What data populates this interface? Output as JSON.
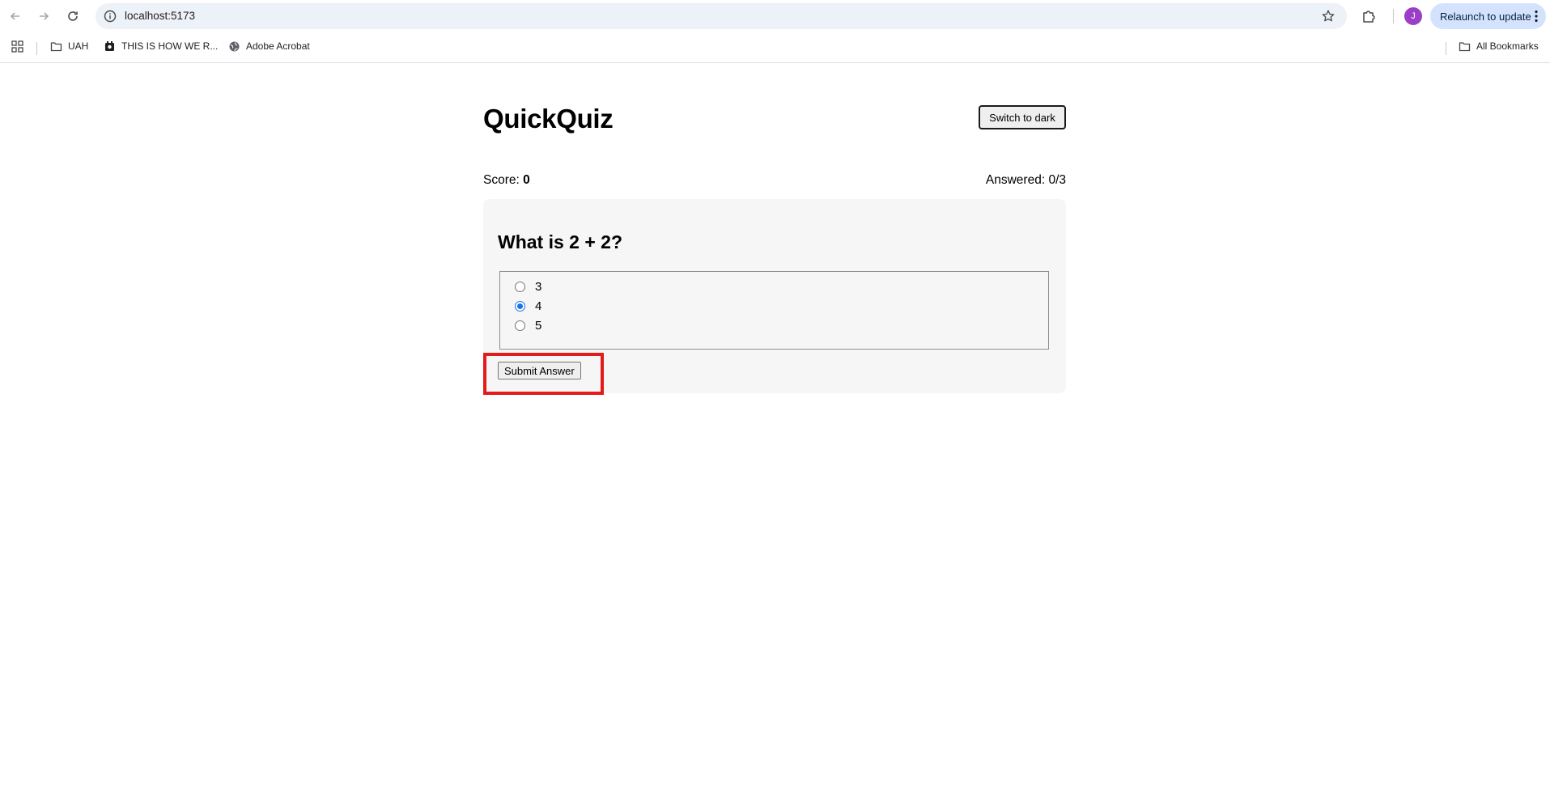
{
  "browser": {
    "url": "localhost:5173",
    "avatar_letter": "J",
    "relaunch_label": "Relaunch to update",
    "bookmarks": [
      {
        "label": "UAH",
        "icon": "folder-icon"
      },
      {
        "label": "THIS IS HOW WE R...",
        "icon": "site-icon"
      },
      {
        "label": "Adobe Acrobat",
        "icon": "globe-icon"
      }
    ],
    "all_bookmarks_label": "All Bookmarks"
  },
  "app": {
    "title": "QuickQuiz",
    "theme_button_label": "Switch to dark",
    "score_label": "Score:",
    "score_value": "0",
    "answered_text": "Answered: 0/3",
    "question": "What is 2 + 2?",
    "options": [
      {
        "label": "3",
        "selected": false
      },
      {
        "label": "4",
        "selected": true
      },
      {
        "label": "5",
        "selected": false
      }
    ],
    "submit_label": "Submit Answer"
  },
  "colors": {
    "highlight": "#e31b1b",
    "radio_selected": "#1a73e8",
    "card_background": "#f6f6f6"
  }
}
